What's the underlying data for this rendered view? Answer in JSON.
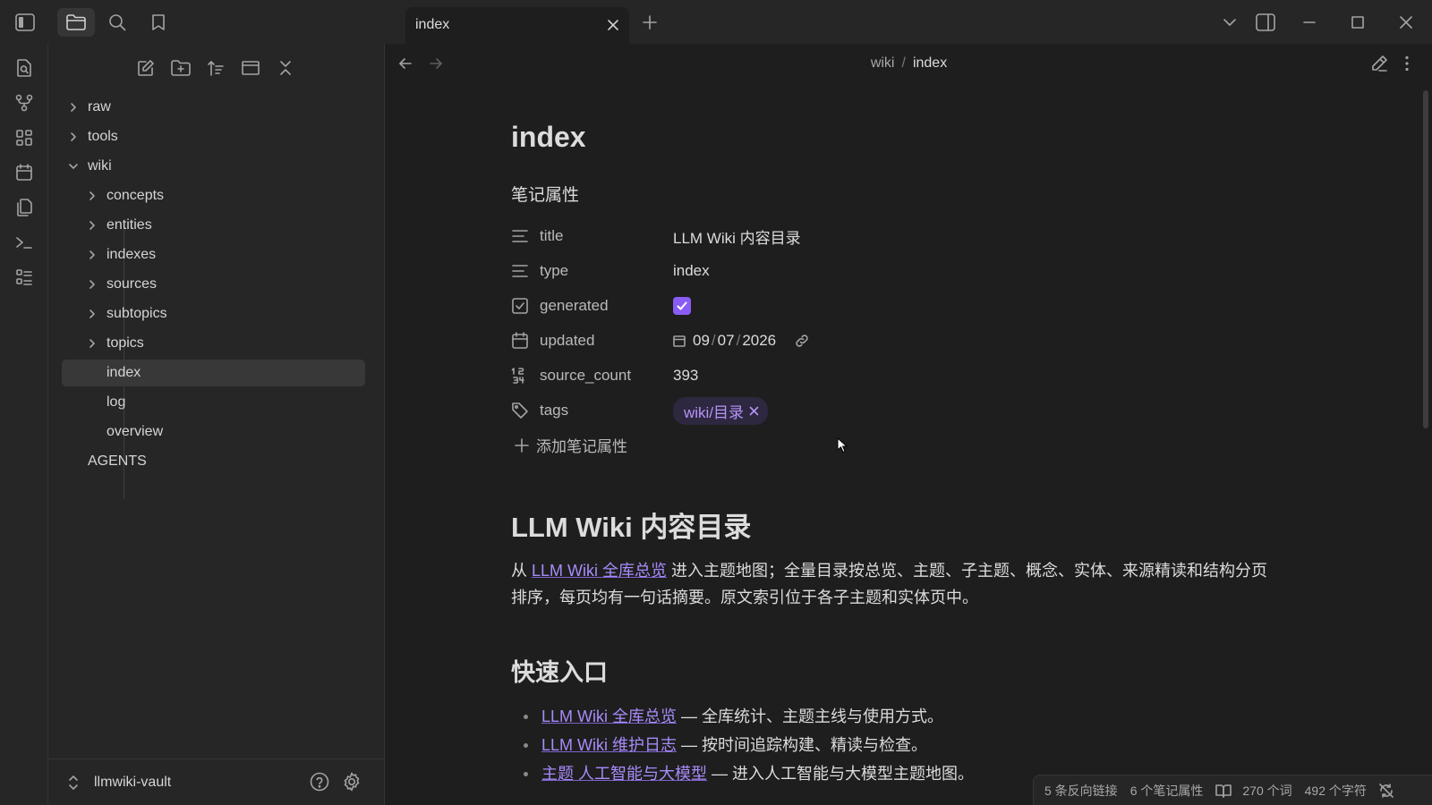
{
  "tab": {
    "title": "index"
  },
  "breadcrumb": {
    "folder": "wiki",
    "separator": "/",
    "current": "index"
  },
  "sidebar": {
    "tree": [
      {
        "label": "raw"
      },
      {
        "label": "tools"
      },
      {
        "label": "wiki"
      },
      {
        "label": "concepts"
      },
      {
        "label": "entities"
      },
      {
        "label": "indexes"
      },
      {
        "label": "sources"
      },
      {
        "label": "subtopics"
      },
      {
        "label": "topics"
      },
      {
        "label": "index"
      },
      {
        "label": "log"
      },
      {
        "label": "overview"
      },
      {
        "label": "AGENTS"
      }
    ],
    "vault_name": "llmwiki-vault"
  },
  "note": {
    "title": "index",
    "properties_heading": "笔记属性",
    "properties": [
      {
        "key": "title",
        "value": "LLM Wiki 内容目录"
      },
      {
        "key": "type",
        "value": "index"
      },
      {
        "key": "generated",
        "value": true
      },
      {
        "key": "updated",
        "date": {
          "mm": "09",
          "dd": "07",
          "yyyy": "2026"
        }
      },
      {
        "key": "source_count",
        "value": "393"
      },
      {
        "key": "tags",
        "tag": "wiki/目录"
      }
    ],
    "add_property": "添加笔记属性",
    "heading1": "LLM Wiki 内容目录",
    "paragraph": {
      "prefix": "从 ",
      "link": "LLM Wiki 全库总览",
      "suffix": " 进入主题地图；全量目录按总览、主题、子主题、概念、实体、来源精读和结构分页排序，每页均有一句话摘要。原文索引位于各子主题和实体页中。"
    },
    "heading2": "快速入口",
    "quick_links": [
      {
        "link": "LLM Wiki 全库总览",
        "text": " — 全库统计、主题主线与使用方式。"
      },
      {
        "link": "LLM Wiki 维护日志",
        "text": " — 按时间追踪构建、精读与检查。"
      },
      {
        "link": "主题 人工智能与大模型",
        "text": " — 进入人工智能与大模型主题地图。"
      }
    ]
  },
  "statusbar": {
    "backlinks": "5 条反向链接",
    "properties": "6 个笔记属性",
    "words": "270 个词",
    "chars": "492 个字符"
  },
  "colors": {
    "accent": "#8a5cf5",
    "link": "#a88bfa",
    "tag_bg": "#2d2740"
  }
}
